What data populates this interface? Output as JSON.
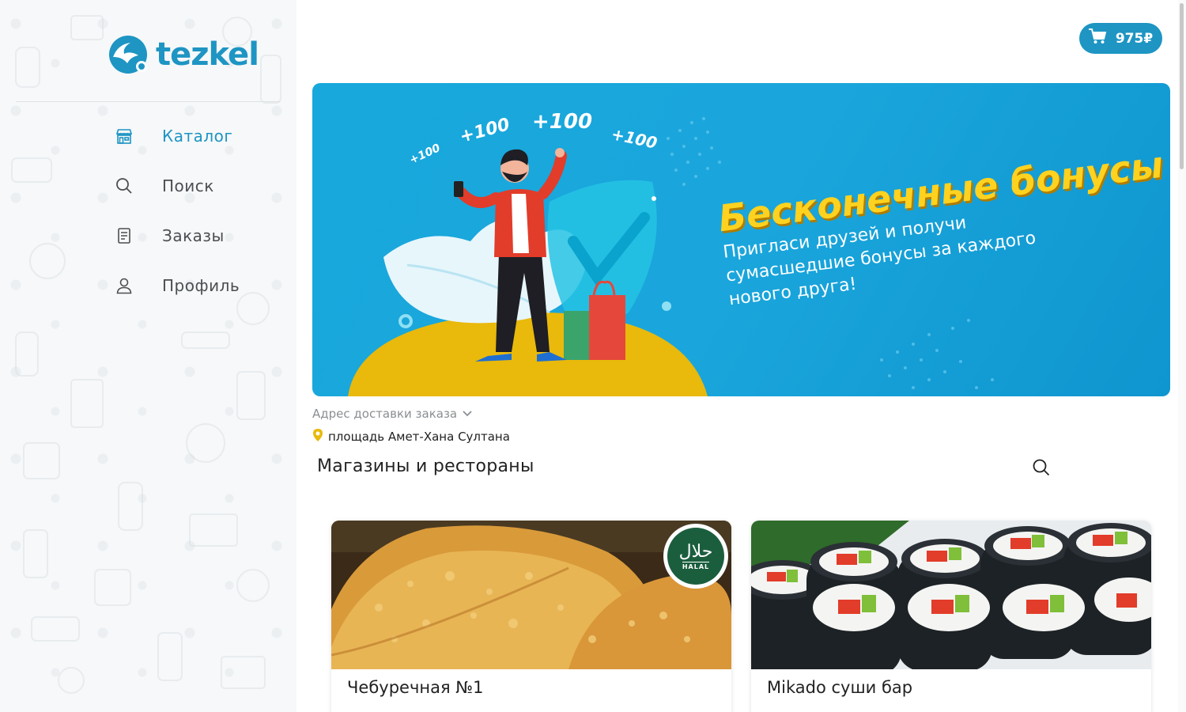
{
  "app": {
    "logo_text": "tezkel"
  },
  "sidebar": {
    "items": [
      {
        "label": "Каталог",
        "icon": "store-icon",
        "active": true
      },
      {
        "label": "Поиск",
        "icon": "search-icon",
        "active": false
      },
      {
        "label": "Заказы",
        "icon": "orders-icon",
        "active": false
      },
      {
        "label": "Профиль",
        "icon": "user-icon",
        "active": false
      }
    ]
  },
  "header": {
    "cart_total": "975₽",
    "cart_icon": "cart-icon"
  },
  "banner": {
    "title": "Бесконечные бонусы",
    "subtitle": "Пригласи друзей и получи сумасшедшие бонусы за каждого нового друга!",
    "bonus_tags": [
      "+100",
      "+100",
      "+100",
      "+100"
    ]
  },
  "delivery": {
    "label": "Адрес доставки заказа",
    "address": "площадь Амет-Хана Султана"
  },
  "main": {
    "section_title": "Магазины и рестораны",
    "cards": [
      {
        "name": "Чебуречная №1",
        "badge_ar": "حلال",
        "badge_en": "HALAL"
      },
      {
        "name": "Mikado суши бар"
      }
    ]
  },
  "colors": {
    "accent": "#1e95c3",
    "banner_yellow": "#ffd21f",
    "halal_green": "#1b5e3e"
  }
}
